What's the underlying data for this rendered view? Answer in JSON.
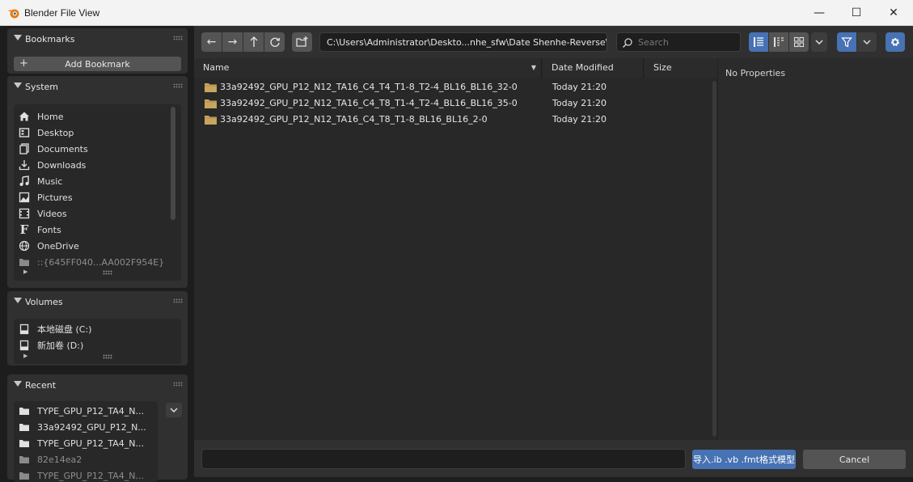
{
  "window": {
    "title": "Blender File View",
    "minimize": "—",
    "maximize": "☐",
    "close": "✕"
  },
  "bookmarks": {
    "label": "Bookmarks",
    "add_label": "Add Bookmark"
  },
  "system": {
    "label": "System",
    "items": [
      {
        "label": "Home",
        "icon": "home-icon"
      },
      {
        "label": "Desktop",
        "icon": "desktop-icon"
      },
      {
        "label": "Documents",
        "icon": "documents-icon"
      },
      {
        "label": "Downloads",
        "icon": "downloads-icon"
      },
      {
        "label": "Music",
        "icon": "music-icon"
      },
      {
        "label": "Pictures",
        "icon": "pictures-icon"
      },
      {
        "label": "Videos",
        "icon": "videos-icon"
      },
      {
        "label": "Fonts",
        "icon": "fonts-icon"
      },
      {
        "label": "OneDrive",
        "icon": "globe-icon"
      },
      {
        "label": "::{645FF040...AA002F954E}",
        "icon": "folder-icon"
      }
    ]
  },
  "volumes": {
    "label": "Volumes",
    "items": [
      {
        "label": "本地磁盘 (C:)",
        "icon": "drive-icon"
      },
      {
        "label": "新加卷 (D:)",
        "icon": "drive-icon"
      }
    ]
  },
  "recent": {
    "label": "Recent",
    "items": [
      {
        "label": "TYPE_GPU_P12_TA4_N..."
      },
      {
        "label": "33a92492_GPU_P12_N..."
      },
      {
        "label": "TYPE_GPU_P12_TA4_N..."
      },
      {
        "label": "82e14ea2"
      },
      {
        "label": "TYPE_GPU_P12_TA4_N..."
      }
    ]
  },
  "toolbar": {
    "path": "C:\\Users\\Administrator\\Deskto...nhe_sfw\\Date Shenhe-Reverse\\",
    "search_placeholder": "Search"
  },
  "columns": {
    "name": "Name",
    "date": "Date Modified",
    "size": "Size"
  },
  "files": [
    {
      "name": "33a92492_GPU_P12_N12_TA16_C4_T4_T1-8_T2-4_BL16_BL16_32-0",
      "date": "Today 21:20"
    },
    {
      "name": "33a92492_GPU_P12_N12_TA16_C4_T8_T1-4_T2-4_BL16_BL16_35-0",
      "date": "Today 21:20"
    },
    {
      "name": "33a92492_GPU_P12_N12_TA16_C4_T8_T1-8_BL16_BL16_2-0",
      "date": "Today 21:20"
    }
  ],
  "properties": {
    "empty_label": "No Properties"
  },
  "footer": {
    "execute_label": "导入.ib .vb .fmt格式模型",
    "cancel_label": "Cancel"
  },
  "colors": {
    "accent": "#4772b3",
    "folder": "#c9a55c"
  }
}
